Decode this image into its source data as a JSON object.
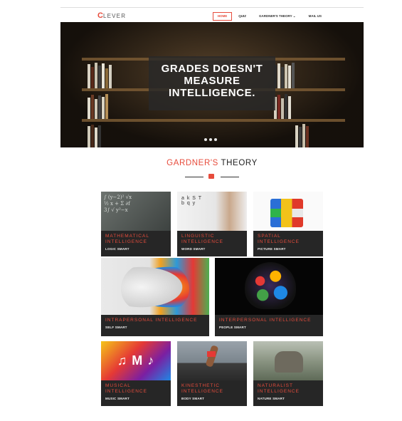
{
  "brand": {
    "logo_initial": "C",
    "logo_rest": "LEVER"
  },
  "nav": {
    "items": [
      {
        "label": "HOME",
        "active": true
      },
      {
        "label": "QUIZ"
      },
      {
        "label": "GARDNER'S THEORY ⌄"
      },
      {
        "label": "MAIL US"
      }
    ]
  },
  "hero": {
    "headline": "GRADES DOESN'T\nMEASURE\nINTELLIGENCE.",
    "slides": 3
  },
  "section": {
    "title_accent": "GARDNER'S",
    "title_rest": " THEORY"
  },
  "cards": [
    {
      "title": "MATHEMATICAL\nINTELLIGENCE",
      "sub": "LOGIC SMART"
    },
    {
      "title": "LINGUISTIC\nINTELLIGENCE",
      "sub": "WORD SMART"
    },
    {
      "title": "SPATIAL\nINTELLIGENCE",
      "sub": "PICTURE SMART"
    },
    {
      "title": "INTRAPERSONAL INTELLIGENCE",
      "sub": "SELF SMART"
    },
    {
      "title": "INTERPERSONAL INTELLIGENCE",
      "sub": "PEOPLE SMART"
    },
    {
      "title": "MUSICAL\nINTELLIGENCE",
      "sub": "MUSIC SMART"
    },
    {
      "title": "KINESTHETIC\nINTELLIGENCE",
      "sub": "BODY SMART"
    },
    {
      "title": "NATURALIST\nINTELLIGENCE",
      "sub": "NATURE SMART"
    }
  ],
  "colors": {
    "accent": "#e74c3c",
    "caption_bg": "#262626"
  }
}
